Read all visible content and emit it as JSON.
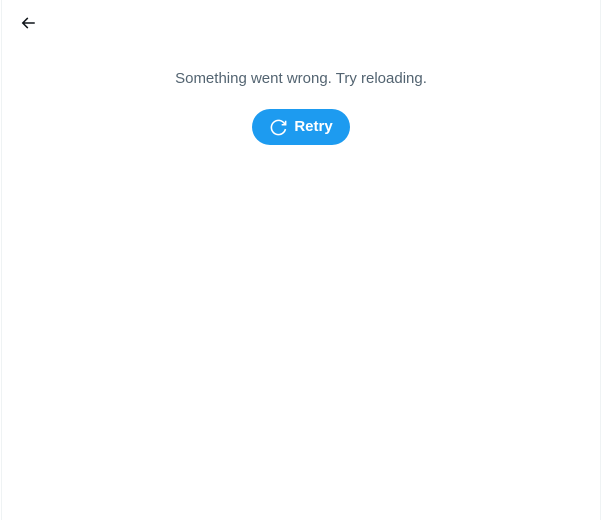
{
  "header": {
    "back_icon": "arrow-left-icon"
  },
  "error": {
    "message": "Something went wrong. Try reloading.",
    "retry_label": "Retry",
    "retry_icon": "refresh-icon"
  },
  "colors": {
    "accent": "#1d9bf0",
    "muted_text": "#536471",
    "border": "#eff3f4"
  }
}
